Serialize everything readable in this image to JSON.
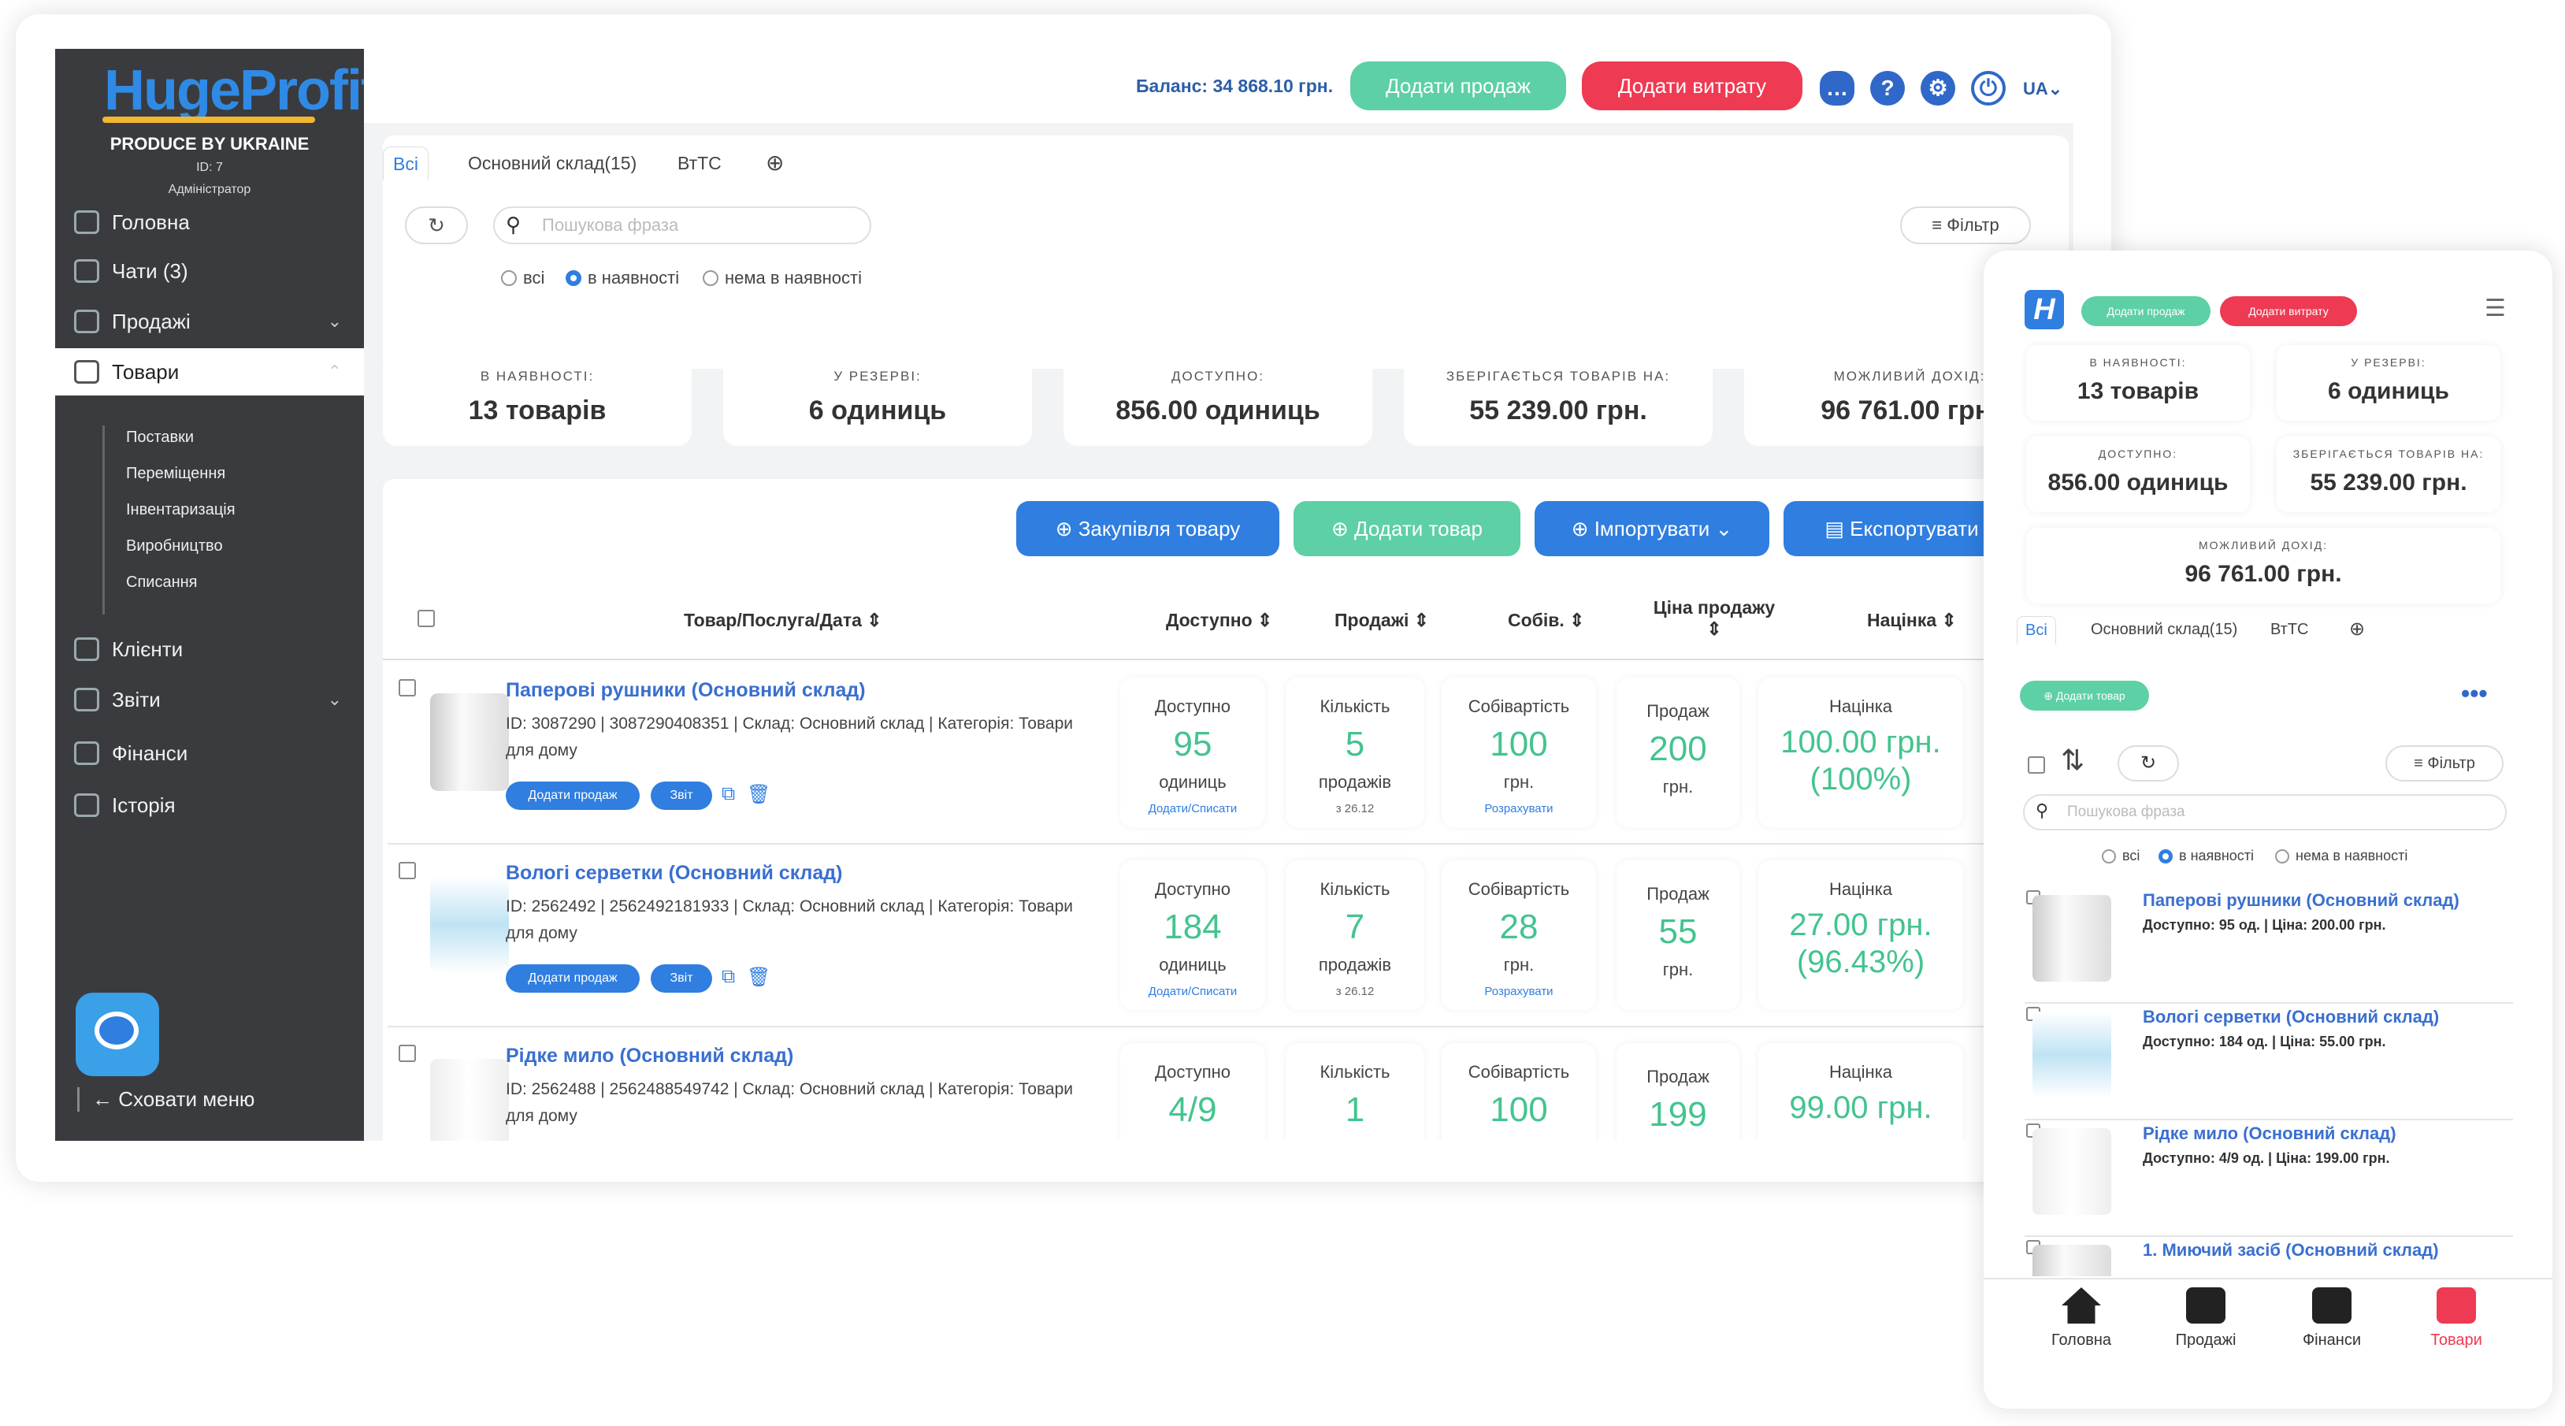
{
  "brand": {
    "logo": "HugeProfit",
    "tagline": "PRODUCE BY UKRAINE",
    "user_id": "ID: 7",
    "role": "Адміністратор"
  },
  "sidebar": {
    "items": [
      "Головна",
      "Чати (3)",
      "Продажі",
      "Товари",
      "Клієнти",
      "Звіти",
      "Фінанси",
      "Історія"
    ],
    "subitems": [
      "Поставки",
      "Переміщення",
      "Інвентаризація",
      "Виробництво",
      "Списання"
    ],
    "hide_menu": "Сховати меню"
  },
  "header": {
    "balance": "Баланс: 34 868.10 грн.",
    "add_sale": "Додати продаж",
    "add_expense": "Додати витрату",
    "lang": "UA"
  },
  "tabs": [
    "Всі",
    "Основний склад(15)",
    "ВтТС"
  ],
  "search": {
    "placeholder": "Пошукова фраза",
    "filter": "Фільтр"
  },
  "radios": [
    "всі",
    "в наявності",
    "нема в наявності"
  ],
  "stats": [
    {
      "label": "В НАЯВНОСТІ:",
      "value": "13 товарів"
    },
    {
      "label": "У РЕЗЕРВІ:",
      "value": "6 одиниць"
    },
    {
      "label": "ДОСТУПНО:",
      "value": "856.00 одиниць"
    },
    {
      "label": "ЗБЕРІГАЄТЬСЯ ТОВАРІВ НА:",
      "value": "55 239.00 грн."
    },
    {
      "label": "МОЖЛИВИЙ ДОХІД:",
      "value": "96 761.00 грн."
    }
  ],
  "actions": {
    "purchase": "Закупівля товару",
    "add_product": "Додати товар",
    "import": "Імпортувати",
    "export": "Експортувати"
  },
  "columns": [
    "Товар/Послуга/Дата",
    "Доступно",
    "Продажі",
    "Собів.",
    "Ціна продажу",
    "Націнка"
  ],
  "rows": [
    {
      "name": "Паперові рушники (Основний склад)",
      "meta": "ID: 3087290 | 3087290408351 | Склад: Основний склад | Категорія: Товари для дому",
      "avail": "95",
      "avail_unit": "одиниць",
      "avail_link": "Додати/Списати",
      "qty": "5",
      "qty_unit": "продажів",
      "qty_date": "з 26.12",
      "cost": "100",
      "cost_unit": "грн.",
      "cost_link": "Розрахувати",
      "price": "200",
      "price_unit": "грн.",
      "markup": "100.00 грн.",
      "markup_pct": "(100%)"
    },
    {
      "name": "Вологі серветки (Основний склад)",
      "meta": "ID: 2562492 | 2562492181933 | Склад: Основний склад | Категорія: Товари для дому",
      "avail": "184",
      "avail_unit": "одиниць",
      "avail_link": "Додати/Списати",
      "qty": "7",
      "qty_unit": "продажів",
      "qty_date": "з 26.12",
      "cost": "28",
      "cost_unit": "грн.",
      "cost_link": "Розрахувати",
      "price": "55",
      "price_unit": "грн.",
      "markup": "27.00 грн.",
      "markup_pct": "(96.43%)"
    },
    {
      "name": "Рідке мило (Основний склад)",
      "meta": "ID: 2562488 | 2562488549742 | Склад: Основний склад | Категорія: Товари для дому",
      "avail": "4/9",
      "avail_unit": "",
      "avail_link": "",
      "qty": "1",
      "qty_unit": "",
      "qty_date": "",
      "cost": "100",
      "cost_unit": "",
      "cost_link": "",
      "price": "199",
      "price_unit": "",
      "markup": "99.00 грн.",
      "markup_pct": ""
    }
  ],
  "cell_labels": {
    "avail": "Доступно",
    "qty": "Кількість",
    "cost": "Собівартість",
    "price": "Продаж",
    "markup": "Націнка"
  },
  "row_buttons": {
    "sale": "Додати продаж",
    "report": "Звіт"
  },
  "mobile": {
    "stats": [
      {
        "label": "В НАЯВНОСТІ:",
        "value": "13 товарів"
      },
      {
        "label": "У РЕЗЕРВІ:",
        "value": "6 одиниць"
      },
      {
        "label": "ДОСТУПНО:",
        "value": "856.00 одиниць"
      },
      {
        "label": "ЗБЕРІГАЄТЬСЯ ТОВАРІВ НА:",
        "value": "55 239.00 грн."
      },
      {
        "label": "МОЖЛИВИЙ ДОХІД:",
        "value": "96 761.00 грн."
      }
    ],
    "add_product": "Додати товар",
    "items": [
      {
        "name": "Паперові рушники (Основний склад)",
        "detail": "Доступно: 95 од. | Ціна: 200.00 грн."
      },
      {
        "name": "Вологі серветки (Основний склад)",
        "detail": "Доступно: 184 од. | Ціна: 55.00 грн."
      },
      {
        "name": "Рідке мило (Основний склад)",
        "detail": "Доступно: 4/9 од. | Ціна: 199.00 грн."
      },
      {
        "name": "1. Миючий засіб (Основний склад)",
        "detail": ""
      }
    ],
    "bottom_nav": [
      "Головна",
      "Продажі",
      "Фінанси",
      "Товари"
    ]
  },
  "colors": {
    "green": "#5dd0a5",
    "red": "#ee3a53",
    "blue": "#2f7ee0",
    "sidebar": "#3a3b3f"
  }
}
